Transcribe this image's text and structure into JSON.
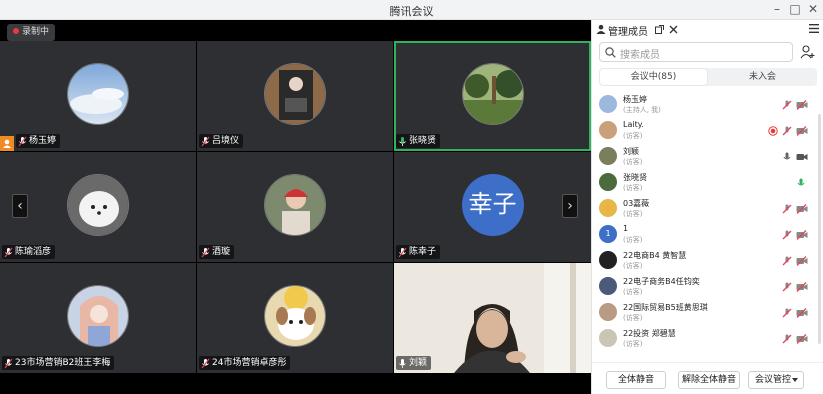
{
  "window": {
    "title": "腾讯会议",
    "minimize": "–",
    "maximize": "□",
    "close": "✕"
  },
  "recording": {
    "label": "录制中"
  },
  "tiles": [
    {
      "name": "杨玉婷",
      "avatar": "sky"
    },
    {
      "name": "吕境仪",
      "avatar": "dark"
    },
    {
      "name": "张晓贤",
      "avatar": "trees"
    },
    {
      "name": "陈瑜滔彦",
      "avatar": "dog"
    },
    {
      "name": "酒璇",
      "avatar": "girl"
    },
    {
      "name": "陈幸子",
      "avatar_text": "幸子"
    },
    {
      "name": "23市场营销B2班王李梅",
      "avatar": "anime"
    },
    {
      "name": "24市场营销卓彦彤",
      "avatar": "puppy"
    },
    {
      "name": "刘颖",
      "avatar": "video"
    }
  ],
  "panel": {
    "title": "管理成员",
    "search_placeholder": "搜索成员",
    "tab_in_meeting": "会议中(85)",
    "tab_not_joined": "未入会",
    "members": [
      {
        "name": "杨玉婷",
        "role": "(主持人, 我)",
        "avatar_color": "#9cb9dd"
      },
      {
        "name": "Laity.",
        "role": "(访客)",
        "avatar_color": "#c9a07a"
      },
      {
        "name": "刘颖",
        "role": "(访客)",
        "avatar_color": "#7a7e5c"
      },
      {
        "name": "张晓贤",
        "role": "(访客)",
        "avatar_color": "#4b6b3c"
      },
      {
        "name": "03嘉薇",
        "role": "(访客)",
        "avatar_color": "#e7b54a"
      },
      {
        "name": "1",
        "role": "(访客)",
        "avatar_color": "#3d6ec8",
        "avatar_text": "1"
      },
      {
        "name": "22电商B4 黄智慧",
        "role": "(访客)",
        "avatar_color": "#222"
      },
      {
        "name": "22电子商务B4任钧奕",
        "role": "(访客)",
        "avatar_color": "#4a5a78"
      },
      {
        "name": "22国际贸易B5班黄思琪",
        "role": "(访客)",
        "avatar_color": "#b99a85"
      },
      {
        "name": "22投资 郑碧慧",
        "role": "(访客)",
        "avatar_color": "#c9c6b6"
      }
    ],
    "btn_mute_all": "全体静音",
    "btn_unmute_all": "解除全体静音",
    "btn_control": "会议管控"
  },
  "colors": {
    "active_border": "#2fb35c",
    "muted_mic": "#e0455a",
    "recording": "#e63b3b",
    "host_badge": "#f08a24"
  }
}
